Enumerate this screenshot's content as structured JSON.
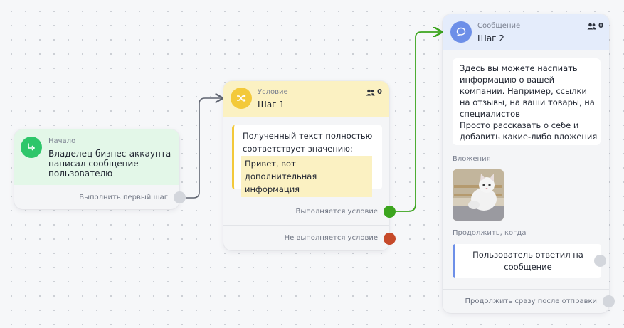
{
  "start_node": {
    "type_label": "Начало",
    "title": "Владелец бизнес-аккаунта написал сообщение пользователю",
    "action_label": "Выполнить первый шаг"
  },
  "condition_node": {
    "type_label": "Условие",
    "title": "Шаг 1",
    "users_count": "0",
    "condition_text": "Полученный текст полностью соответствует значению:",
    "condition_value": "Привет, вот дополнительная информация",
    "yes_label": "Выполняется условие",
    "no_label": "Не выполняется условие"
  },
  "message_node": {
    "type_label": "Сообщение",
    "title": "Шаг 2",
    "users_count": "0",
    "message_text_lines": [
      "Здесь вы можете наспиать",
      "информацию о вашей",
      "компании. Например, ссылки",
      "на отзывы, на ваши товары, на",
      "специалистов",
      "Просто рассказать о себе и",
      "добавить какие-либо вложения"
    ],
    "attachments_label": "Вложения",
    "continue_label": "Продолжить, когда",
    "continue_option": "Пользователь ответил на сообщение",
    "continue_after_send": "Продолжить сразу после отправки"
  },
  "colors": {
    "start_accent": "#2ec66a",
    "condition_accent": "#f3c93a",
    "message_accent": "#6d8fe8",
    "link_grey": "#5f6470",
    "link_green": "#3ca51e"
  }
}
